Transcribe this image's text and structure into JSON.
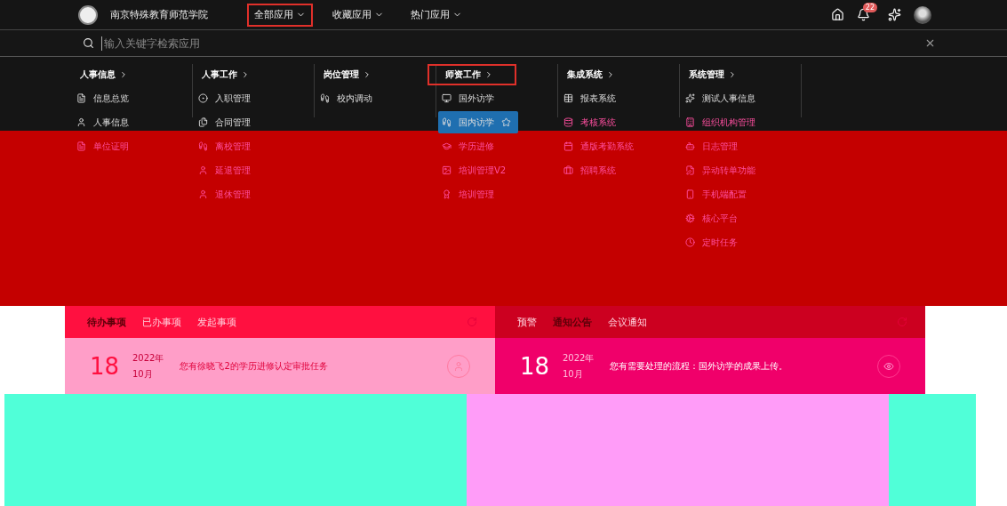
{
  "header": {
    "school_name": "南京特殊教育师范学院",
    "nav": [
      {
        "label": "全部应用",
        "selected": true
      },
      {
        "label": "收藏应用",
        "selected": false
      },
      {
        "label": "热门应用",
        "selected": false
      }
    ],
    "notification_count": "22"
  },
  "search": {
    "placeholder": "输入关键字检索应用"
  },
  "menu": [
    {
      "title": "人事信息",
      "selected": false,
      "items": [
        {
          "label": "信息总览",
          "selected": false
        },
        {
          "label": "人事信息",
          "selected": false
        },
        {
          "label": "单位证明",
          "selected": false
        }
      ]
    },
    {
      "title": "人事工作",
      "selected": false,
      "items": [
        {
          "label": "入职管理",
          "selected": false
        },
        {
          "label": "合同管理",
          "selected": false
        },
        {
          "label": "离校管理",
          "selected": false
        },
        {
          "label": "延退管理",
          "selected": false
        },
        {
          "label": "退休管理",
          "selected": false
        }
      ]
    },
    {
      "title": "岗位管理",
      "selected": false,
      "items": [
        {
          "label": "校内调动",
          "selected": false
        }
      ]
    },
    {
      "title": "师资工作",
      "selected": true,
      "items": [
        {
          "label": "国外访学",
          "selected": false
        },
        {
          "label": "国内访学",
          "selected": true
        },
        {
          "label": "学历进修",
          "selected": false
        },
        {
          "label": "培训管理V2",
          "selected": false
        },
        {
          "label": "培训管理",
          "selected": false
        }
      ]
    },
    {
      "title": "集成系统",
      "selected": false,
      "items": [
        {
          "label": "报表系统",
          "selected": false
        },
        {
          "label": "考核系统",
          "selected": false
        },
        {
          "label": "通版考勤系统",
          "selected": false
        },
        {
          "label": "招聘系统",
          "selected": false
        }
      ]
    },
    {
      "title": "系统管理",
      "selected": false,
      "items": [
        {
          "label": "测试人事信息",
          "selected": false
        },
        {
          "label": "组织机构管理",
          "selected": false
        },
        {
          "label": "日志管理",
          "selected": false
        },
        {
          "label": "异动转单功能",
          "selected": false
        },
        {
          "label": "手机端配置",
          "selected": false
        },
        {
          "label": "核心平台",
          "selected": false
        },
        {
          "label": "定时任务",
          "selected": false
        }
      ]
    }
  ],
  "panels": [
    {
      "tabs": [
        {
          "label": "待办事项",
          "selected": true
        },
        {
          "label": "已办事项",
          "selected": false
        },
        {
          "label": "发起事项",
          "selected": false
        }
      ],
      "rows": [
        {
          "day": "18",
          "year": "2022年",
          "month": "10月",
          "text": "您有徐晓飞2的学历进修认定审批任务",
          "kind": "user"
        }
      ]
    },
    {
      "tabs": [
        {
          "label": "预警",
          "selected": false
        },
        {
          "label": "通知公告",
          "selected": true
        },
        {
          "label": "会议通知",
          "selected": false
        }
      ],
      "rows": [
        {
          "day": "18",
          "year": "2022年",
          "month": "10月",
          "text": "您有需要处理的流程：国外访学的成果上传。",
          "kind": "view"
        }
      ]
    }
  ]
}
